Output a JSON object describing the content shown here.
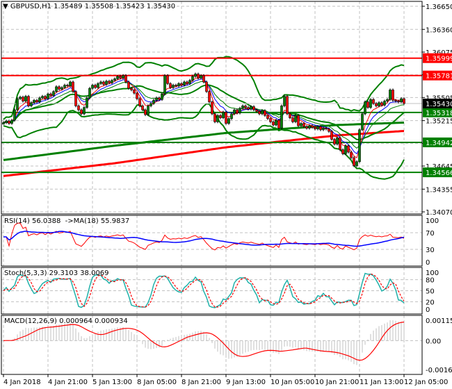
{
  "header": {
    "symbol_tf": "GBPUSD,H1",
    "open": "1.35489",
    "high": "1.35508",
    "low": "1.35423",
    "close": "1.35430"
  },
  "indicators": {
    "rsi_label": "RSI(14) 56.0388  ->MA(18) 55.9837",
    "stoch_label": "Stoch(5,3,3) 29.3103 38.0069",
    "macd_label": "MACD(12,26,9) 0.000964 0.000934"
  },
  "colors": {
    "bull": "#008000",
    "bear": "#ff0000",
    "resistance": "#ff0000",
    "support": "#008000",
    "bollinger": "#008000",
    "rsi": "#ff0000",
    "rsi_ma": "#0000ff",
    "stoch_main": "#20b2aa",
    "stoch_signal": "#ff0000",
    "macd_hist": "#c0c0c0",
    "macd_signal": "#ff0000",
    "current_price_bg": "#000000"
  },
  "chart_data": {
    "type": "candlestick",
    "symbol": "GBPUSD",
    "timeframe": "H1",
    "ylim": [
      1.3407,
      1.3665
    ],
    "price_ticks": [
      "1.36650",
      "1.36360",
      "1.36075",
      "1.35790",
      "1.35505",
      "1.35215",
      "1.34930",
      "1.34645",
      "1.34355",
      "1.34070"
    ],
    "time_labels": [
      "4 Jan 2018",
      "4 Jan 21:00",
      "5 Jan 13:00",
      "8 Jan 05:00",
      "8 Jan 21:00",
      "9 Jan 13:00",
      "10 Jan 05:00",
      "10 Jan 21:00",
      "11 Jan 13:00",
      "12 Jan 05:00"
    ],
    "time_label_step_bars": 16,
    "closes": [
      1.3519,
      1.3521,
      1.3518,
      1.3522,
      1.3535,
      1.3549,
      1.3551,
      1.3546,
      1.3552,
      1.354,
      1.3544,
      1.3547,
      1.3545,
      1.355,
      1.3552,
      1.3549,
      1.3555,
      1.3553,
      1.3558,
      1.3564,
      1.3561,
      1.3563,
      1.3566,
      1.3565,
      1.357,
      1.3558,
      1.354,
      1.3535,
      1.353,
      1.3538,
      1.355,
      1.3562,
      1.3566,
      1.3563,
      1.3568,
      1.357,
      1.3567,
      1.3571,
      1.3569,
      1.3572,
      1.3574,
      1.3577,
      1.3575,
      1.3578,
      1.357,
      1.3562,
      1.356,
      1.3556,
      1.3549,
      1.354,
      1.3535,
      1.3529,
      1.354,
      1.3543,
      1.3547,
      1.355,
      1.3548,
      1.3555,
      1.3578,
      1.3568,
      1.3563,
      1.3566,
      1.3565,
      1.3568,
      1.3566,
      1.357,
      1.3568,
      1.3572,
      1.3577,
      1.358,
      1.3575,
      1.3578,
      1.357,
      1.3558,
      1.3545,
      1.353,
      1.352,
      1.3528,
      1.3525,
      1.3532,
      1.3518,
      1.3524,
      1.353,
      1.3535,
      1.3531,
      1.3537,
      1.354,
      1.3538,
      1.3536,
      1.3539,
      1.3535,
      1.3533,
      1.353,
      1.3534,
      1.3528,
      1.3524,
      1.352,
      1.3516,
      1.3522,
      1.3512,
      1.354,
      1.3552,
      1.353,
      1.3525,
      1.352,
      1.3528,
      1.3515,
      1.3518,
      1.3514,
      1.3512,
      1.3515,
      1.3513,
      1.3511,
      1.3514,
      1.351,
      1.3512,
      1.3511,
      1.3508,
      1.3498,
      1.3492,
      1.35,
      1.3485,
      1.348,
      1.349,
      1.3482,
      1.3475,
      1.3465,
      1.347,
      1.351,
      1.353,
      1.3545,
      1.3538,
      1.3548,
      1.3543,
      1.354,
      1.3544,
      1.3541,
      1.3546,
      1.3548,
      1.356,
      1.3547,
      1.3546,
      1.3545,
      1.3549,
      1.3543
    ],
    "levels": [
      {
        "value": "1.35999",
        "kind": "resistance"
      },
      {
        "value": "1.35781",
        "kind": "resistance"
      },
      {
        "value": "1.35318",
        "kind": "support"
      },
      {
        "value": "1.34942",
        "kind": "support"
      },
      {
        "value": "1.34566",
        "kind": "support"
      }
    ],
    "current_price": "1.35430",
    "long_ma_green": [
      [
        0,
        1.3472
      ],
      [
        40,
        1.349
      ],
      [
        80,
        1.3506
      ],
      [
        120,
        1.3516
      ],
      [
        144,
        1.3519
      ]
    ],
    "long_ma_red": [
      [
        0,
        1.3452
      ],
      [
        40,
        1.3468
      ],
      [
        80,
        1.3488
      ],
      [
        120,
        1.3503
      ],
      [
        144,
        1.35085
      ]
    ],
    "rsi": {
      "ticks": [
        "100",
        "70",
        "30",
        "0"
      ],
      "ylim": [
        0,
        100
      ]
    },
    "stoch": {
      "ticks": [
        "100",
        "80",
        "50",
        "20",
        "0"
      ],
      "ylim": [
        0,
        100
      ]
    },
    "macd": {
      "ticks": [
        "0.001153",
        "0.00",
        "-0.00163"
      ],
      "ylim": [
        -0.00163,
        0.001153
      ]
    }
  }
}
